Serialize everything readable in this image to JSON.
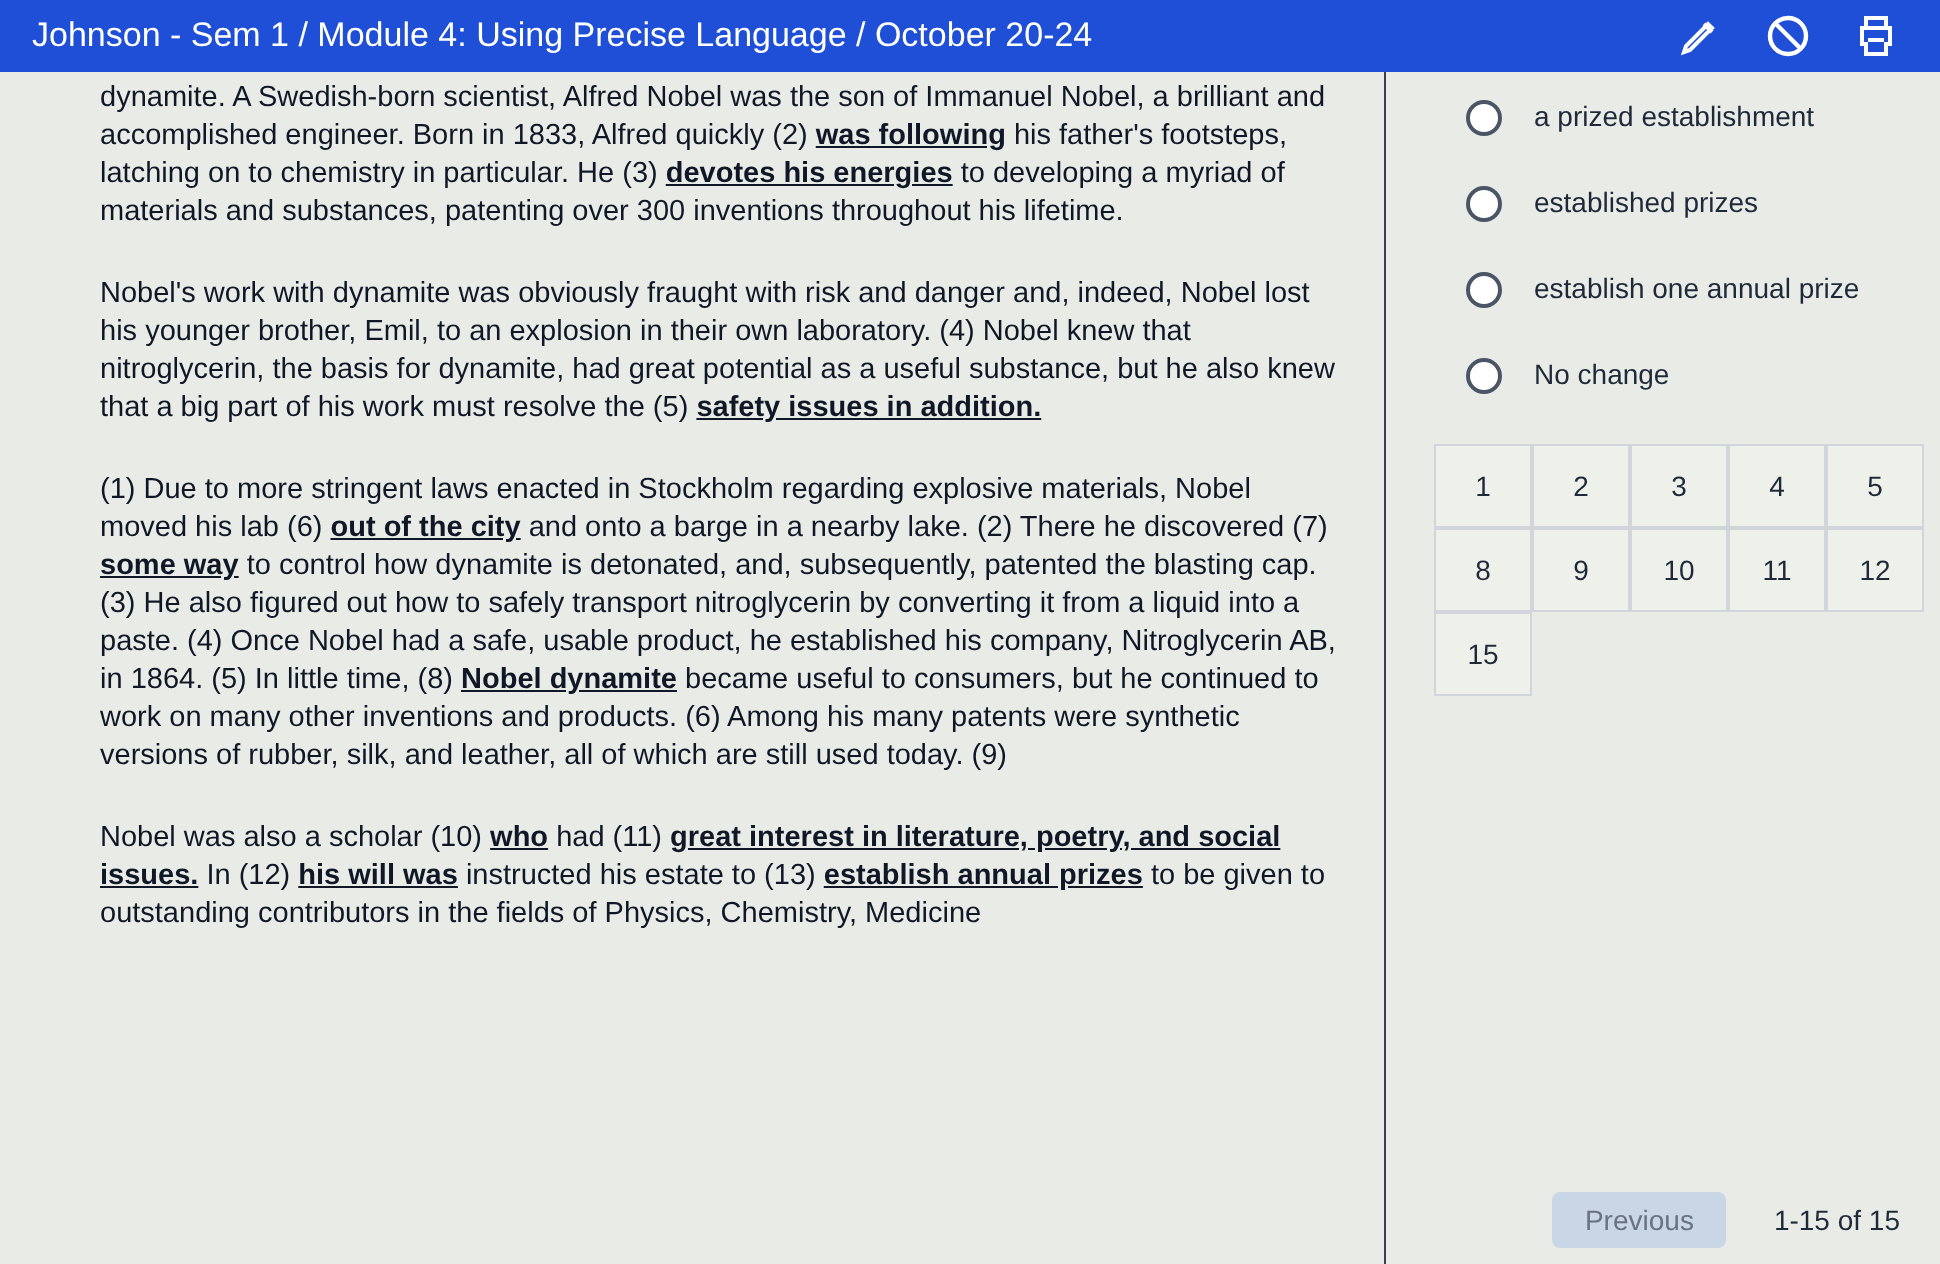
{
  "header": {
    "title": "Johnson - Sem 1 / Module 4: Using Precise Language / October 20-24"
  },
  "passage": {
    "paragraphs": [
      "dynamite. A Swedish-born scientist, Alfred Nobel was the son of Immanuel Nobel, a brilliant and accomplished engineer. Born in 1833, Alfred quickly (2) **was following** his father's footsteps, latching on to chemistry in particular. He (3) **devotes his energies** to developing a myriad of materials and substances, patenting over 300 inventions throughout his lifetime.",
      "Nobel's work with dynamite was obviously fraught with risk and danger and, indeed, Nobel lost his younger brother, Emil, to an explosion in their own laboratory. (4) Nobel knew that nitroglycerin, the basis for dynamite, had great potential as a useful substance, but he also knew that a big part of his work must resolve the (5) **safety issues in addition.**",
      "(1) Due to more stringent laws enacted in Stockholm regarding explosive materials, Nobel moved his lab (6) **out of the city** and onto a barge in a nearby lake. (2) There he discovered (7) **some way** to control how dynamite is detonated, and, subsequently, patented the blasting cap. (3) He also figured out how to safely transport nitroglycerin by converting it from a liquid into a paste. (4) Once Nobel had a safe, usable product, he established his company, Nitroglycerin AB, in 1864. (5) In little time, (8) **Nobel dynamite** became useful to consumers, but he continued to work on many other inventions and products. (6) Among his many patents were synthetic versions of rubber, silk, and leather, all of which are still used today. (9)",
      "Nobel was also a scholar (10) **who** had (11) **great interest in literature, poetry, and social issues.** In (12) **his will was** instructed his estate to (13) **establish annual prizes** to be given to outstanding contributors in the fields of Physics, Chemistry, Medicine"
    ]
  },
  "question": {
    "options": [
      {
        "label": "a prized establishment",
        "selected": false
      },
      {
        "label": "established prizes",
        "selected": false
      },
      {
        "label": "establish one annual prize",
        "selected": false
      },
      {
        "label": "No change",
        "selected": false
      }
    ]
  },
  "navigator": {
    "items": [
      {
        "label": "1"
      },
      {
        "label": "2"
      },
      {
        "label": "3"
      },
      {
        "label": "4"
      },
      {
        "label": "5"
      },
      {
        "label": "8"
      },
      {
        "label": "9"
      },
      {
        "label": "10"
      },
      {
        "label": "11"
      },
      {
        "label": "12"
      },
      {
        "label": "15"
      }
    ]
  },
  "footer": {
    "previous": {
      "label": "Previous",
      "disabled": true
    },
    "range": "1-15 of 15"
  }
}
